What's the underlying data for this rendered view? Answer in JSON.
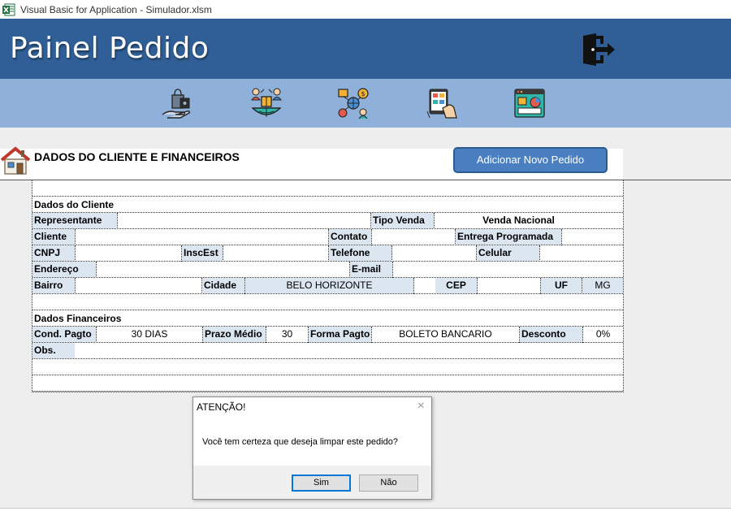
{
  "window": {
    "title": "Visual Basic for Application - Simulador.xlsm"
  },
  "header": {
    "title": "Painel Pedido"
  },
  "toolbar": {
    "icons": [
      "shopping-bag-hand-icon",
      "global-clients-icon",
      "logistics-network-icon",
      "tablet-catalog-icon",
      "dashboard-screen-icon"
    ]
  },
  "section": {
    "heading": "DADOS DO CLIENTE E FINANCEIROS",
    "add_button": "Adicionar Novo Pedido"
  },
  "cliente": {
    "heading": "Dados do Cliente",
    "representante_label": "Representante",
    "tipo_venda_label": "Tipo Venda",
    "tipo_venda_value": "Venda Nacional",
    "cliente_label": "Cliente",
    "contato_label": "Contato",
    "entrega_label": "Entrega Programada",
    "cnpj_label": "CNPJ",
    "inscest_label": "InscEst",
    "telefone_label": "Telefone",
    "celular_label": "Celular",
    "endereco_label": "Endereço",
    "email_label": "E-mail",
    "bairro_label": "Bairro",
    "cidade_label": "Cidade",
    "cidade_value": "BELO HORIZONTE",
    "cep_label": "CEP",
    "uf_label": "UF",
    "uf_value": "MG"
  },
  "financeiro": {
    "heading": "Dados Financeiros",
    "cond_label": "Cond. Pagto",
    "cond_value": "30 DIAS",
    "prazo_label": "Prazo Médio",
    "prazo_value": "30",
    "forma_label": "Forma Pagto",
    "forma_value": "BOLETO BANCARIO",
    "desconto_label": "Desconto",
    "desconto_value": "0%",
    "obs_label": "Obs."
  },
  "dialog": {
    "title": "ATENÇÃO!",
    "message": "Você tem certeza que deseja limpar este pedido?",
    "yes": "Sim",
    "no": "Não",
    "close": "×"
  },
  "colors": {
    "header_blue": "#2f5f96",
    "toolbar_blue": "#8fb0d9",
    "button_blue": "#4a7fc1",
    "cell_shade": "#dce6f1"
  }
}
